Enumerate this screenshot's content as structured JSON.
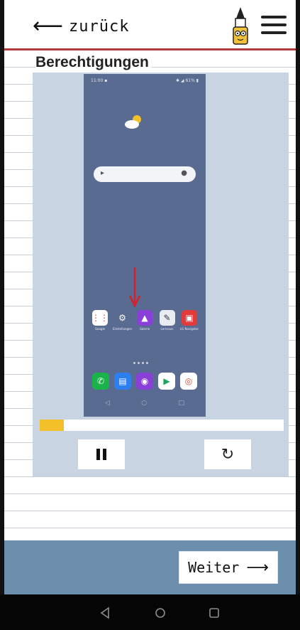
{
  "header": {
    "back_label": "zurück",
    "accent_color": "#b33a3a"
  },
  "page": {
    "title": "Berechtigungen"
  },
  "video": {
    "progress": 0.1,
    "progress_color": "#f4c02a",
    "phone": {
      "status_left": "11:00 ▪",
      "status_right": "✱ ◢ 61% ▮",
      "apps": [
        {
          "name": "Google",
          "icon": "google-folder-icon",
          "color": "#ffffff"
        },
        {
          "name": "Einstellungen",
          "icon": "gear-icon",
          "color": "#5a6b91"
        },
        {
          "name": "Galerie",
          "icon": "gallery-icon",
          "color": "#8a3fd9"
        },
        {
          "name": "Lernsaus",
          "icon": "lernsaus-icon",
          "color": "#e9edf3"
        },
        {
          "name": "LG Navigator",
          "icon": "lg-navigator-icon",
          "color": "#e23a3a"
        }
      ],
      "dock": [
        {
          "icon": "phone-icon",
          "color": "#19b34a"
        },
        {
          "icon": "messages-icon",
          "color": "#2d7ff0"
        },
        {
          "icon": "camera-icon",
          "color": "#8a3fd9"
        },
        {
          "icon": "play-store-icon",
          "color": "#ffffff"
        },
        {
          "icon": "chrome-icon",
          "color": "#ffffff"
        }
      ]
    }
  },
  "controls": {
    "pause_icon": "pause-icon",
    "replay_icon": "replay-icon"
  },
  "footer": {
    "next_label": "Weiter",
    "bar_color": "#6c8fae"
  }
}
